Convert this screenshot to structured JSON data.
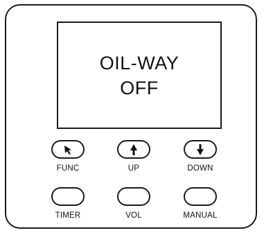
{
  "display": {
    "line1": "OIL-WAY",
    "line2": "OFF"
  },
  "buttons": {
    "func": {
      "label": "FUNC",
      "icon": "cursor-arrow-icon"
    },
    "up": {
      "label": "UP",
      "icon": "arrow-up-icon"
    },
    "down": {
      "label": "DOWN",
      "icon": "arrow-down-icon"
    },
    "timer": {
      "label": "TIMER"
    },
    "vol": {
      "label": "VOL"
    },
    "manual": {
      "label": "MANUAL"
    }
  },
  "colors": {
    "stroke": "#1a1a1a",
    "background": "#ffffff"
  }
}
